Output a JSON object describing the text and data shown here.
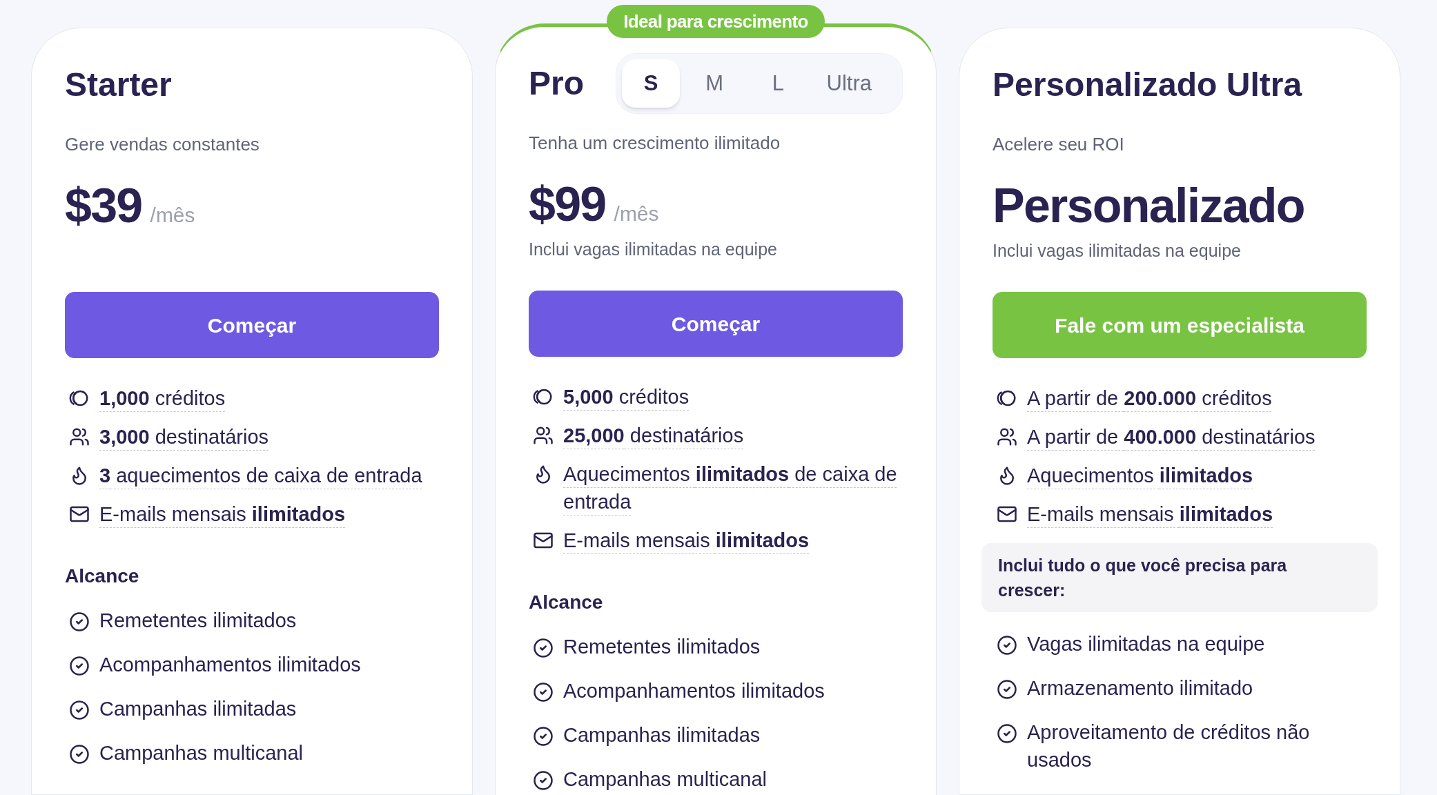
{
  "plans": [
    {
      "name": "Starter",
      "tagline": "Gere vendas constantes",
      "price": {
        "amount": "$39",
        "period": "/mês"
      },
      "button": {
        "label": "Começar",
        "kind": "primary"
      },
      "features": [
        {
          "kind": "credits",
          "text": "**1,000** créditos"
        },
        {
          "kind": "users",
          "text": "**3,000** destinatários"
        },
        {
          "kind": "flame",
          "text": "**3** aquecimentos de caixa de entrada"
        },
        {
          "kind": "mail",
          "text": "E-mails mensais **ilimitados**"
        }
      ],
      "extras": {
        "kind": "heading",
        "title": "Alcance",
        "items": [
          "Remetentes ilimitados",
          "Acompanhamentos ilimitados",
          "Campanhas ilimitadas",
          "Campanhas multicanal"
        ]
      }
    },
    {
      "name": "Pro",
      "badge": "Ideal para crescimento",
      "sizes": [
        {
          "label": "S",
          "selected": true
        },
        {
          "label": "M",
          "selected": false
        },
        {
          "label": "L",
          "selected": false
        },
        {
          "label": "Ultra",
          "selected": false
        }
      ],
      "tagline": "Tenha um crescimento ilimitado",
      "price": {
        "amount": "$99",
        "period": "/mês"
      },
      "note": "Inclui vagas ilimitadas na equipe",
      "button": {
        "label": "Começar",
        "kind": "primary"
      },
      "features": [
        {
          "kind": "credits",
          "text": "**5,000** créditos"
        },
        {
          "kind": "users",
          "text": "**25,000** destinatários"
        },
        {
          "kind": "flame",
          "text": "Aquecimentos **ilimitados** de caixa de entrada"
        },
        {
          "kind": "mail",
          "text": "E-mails mensais **ilimitados**"
        }
      ],
      "extras": {
        "kind": "heading",
        "title": "Alcance",
        "items": [
          "Remetentes ilimitados",
          "Acompanhamentos ilimitados",
          "Campanhas ilimitadas",
          "Campanhas multicanal"
        ]
      }
    },
    {
      "name": "Personalizado Ultra",
      "tagline": "Acelere seu ROI",
      "price": {
        "amount": "Personalizado"
      },
      "note": "Inclui vagas ilimitadas na equipe",
      "button": {
        "label": "Fale com um especialista",
        "kind": "success"
      },
      "features": [
        {
          "kind": "credits",
          "text": "A partir de **200.000** créditos"
        },
        {
          "kind": "users",
          "text": "A partir de **400.000** destinatários"
        },
        {
          "kind": "flame",
          "text": "Aquecimentos **ilimitados**"
        },
        {
          "kind": "mail",
          "text": "E-mails mensais **ilimitados**"
        }
      ],
      "extras": {
        "kind": "callout",
        "title": "Inclui tudo o que você precisa para crescer:",
        "items": [
          "Vagas ilimitadas na equipe",
          "Armazenamento ilimitado",
          "Aproveitamento de créditos não usados"
        ]
      }
    }
  ]
}
